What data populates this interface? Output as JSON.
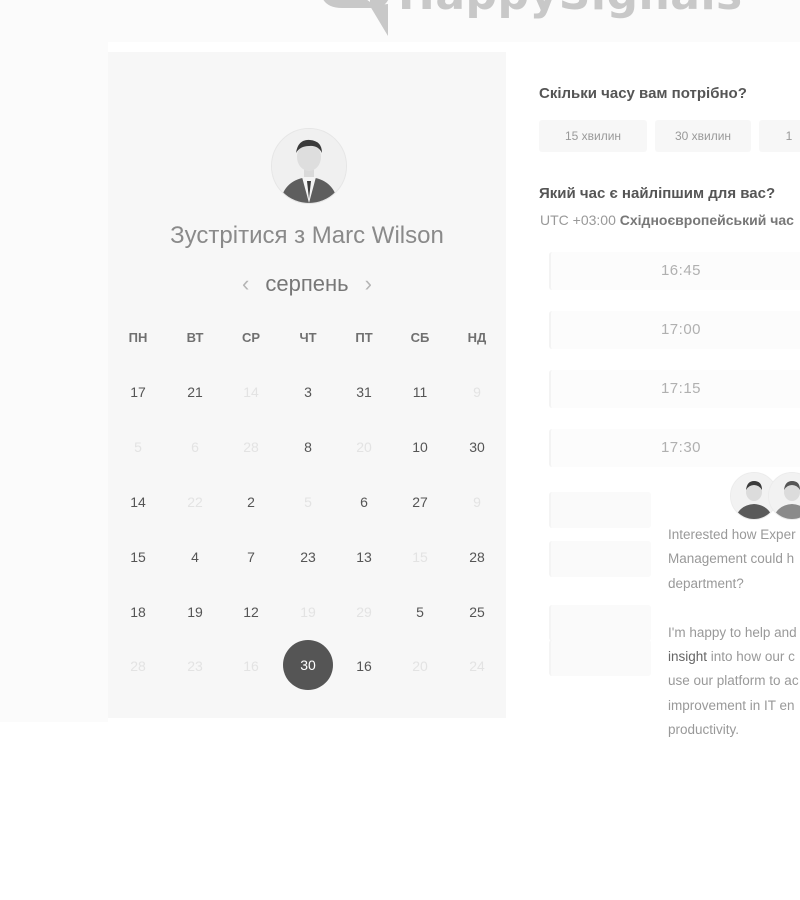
{
  "logo": {
    "text": "HappySignals"
  },
  "calendar": {
    "title": "Зустрітися з Marc Wilson",
    "month": "серпень",
    "prev": "‹",
    "next": "›",
    "weekdays": [
      "ПН",
      "ВТ",
      "СР",
      "ЧТ",
      "ПТ",
      "СБ",
      "НД"
    ],
    "weeks": [
      [
        {
          "d": "17",
          "off": false
        },
        {
          "d": "21",
          "off": false
        },
        {
          "d": "14",
          "off": true
        },
        {
          "d": "3",
          "off": false
        },
        {
          "d": "31",
          "off": false
        },
        {
          "d": "11",
          "off": false
        },
        {
          "d": "9",
          "off": true
        }
      ],
      [
        {
          "d": "5",
          "off": true
        },
        {
          "d": "6",
          "off": true
        },
        {
          "d": "28",
          "off": true
        },
        {
          "d": "8",
          "off": false
        },
        {
          "d": "20",
          "off": true
        },
        {
          "d": "10",
          "off": false
        },
        {
          "d": "30",
          "off": false
        }
      ],
      [
        {
          "d": "14",
          "off": false
        },
        {
          "d": "22",
          "off": true
        },
        {
          "d": "2",
          "off": false
        },
        {
          "d": "5",
          "off": true
        },
        {
          "d": "6",
          "off": false
        },
        {
          "d": "27",
          "off": false
        },
        {
          "d": "9",
          "off": true
        }
      ],
      [
        {
          "d": "15",
          "off": false
        },
        {
          "d": "4",
          "off": false
        },
        {
          "d": "7",
          "off": false
        },
        {
          "d": "23",
          "off": false
        },
        {
          "d": "13",
          "off": false
        },
        {
          "d": "15",
          "off": true
        },
        {
          "d": "28",
          "off": false
        }
      ],
      [
        {
          "d": "18",
          "off": false
        },
        {
          "d": "19",
          "off": false
        },
        {
          "d": "12",
          "off": false
        },
        {
          "d": "19",
          "off": true
        },
        {
          "d": "29",
          "off": true
        },
        {
          "d": "5",
          "off": false
        },
        {
          "d": "25",
          "off": false
        }
      ],
      [
        {
          "d": "28",
          "off": true
        },
        {
          "d": "23",
          "off": true
        },
        {
          "d": "16",
          "off": true
        },
        {
          "d": "30",
          "off": false,
          "selected": true
        },
        {
          "d": "16",
          "off": false
        },
        {
          "d": "20",
          "off": true
        },
        {
          "d": "24",
          "off": true
        }
      ]
    ]
  },
  "duration": {
    "question": "Скільки часу вам потрібно?",
    "options": [
      "15 хвилин",
      "30 хвилин",
      "1"
    ]
  },
  "time": {
    "question": "Який час є найліпшим для вас?",
    "tz_offset": "UTC +03:00",
    "tz_name": "Східноєвропейський час",
    "slots": [
      "16:45",
      "17:00",
      "17:15",
      "17:30"
    ]
  },
  "chat": {
    "lines": [
      {
        "text": "Interested how Exper",
        "hl": ""
      },
      {
        "text": "Management could h",
        "hl": ""
      },
      {
        "text": "department?",
        "hl": ""
      },
      {
        "text": "",
        "hl": ""
      },
      {
        "text": "I'm happy to help and",
        "hl": ""
      },
      {
        "text": " into how our c",
        "hl": "insight"
      },
      {
        "text": "use our platform to ac",
        "hl": ""
      },
      {
        "text": "improvement in IT en",
        "hl": ""
      },
      {
        "text": "productivity.",
        "hl": ""
      }
    ]
  },
  "colors": {
    "selected_day": "#555555",
    "accent_gray": "#c8c8c8"
  }
}
